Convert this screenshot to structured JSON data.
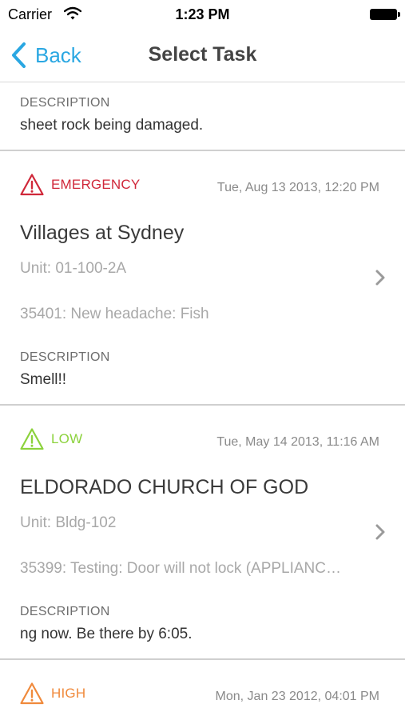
{
  "status_bar": {
    "carrier": "Carrier",
    "time": "1:23 PM"
  },
  "nav": {
    "back_label": "Back",
    "title": "Select Task"
  },
  "partial_card": {
    "description_label": "DESCRIPTION",
    "description": "sheet rock being damaged."
  },
  "tasks": [
    {
      "priority": "EMERGENCY",
      "priority_color": "#d0283a",
      "date": "Tue, Aug 13 2013, 12:20 PM",
      "site": "Villages at Sydney",
      "unit": "Unit: 01-100-2A",
      "task": "35401: New headache: Fish",
      "description_label": "DESCRIPTION",
      "description": "Smell!!"
    },
    {
      "priority": "LOW",
      "priority_color": "#8cd23c",
      "date": "Tue, May 14 2013, 11:16 AM",
      "site": "ELDORADO CHURCH OF GOD",
      "unit": "Unit: Bldg-102",
      "task": "35399: Testing: Door will not lock (APPLIANC…",
      "description_label": "DESCRIPTION",
      "description": "ng now. Be there by 6:05."
    },
    {
      "priority": "HIGH",
      "priority_color": "#f08a3c",
      "date": "Mon, Jan 23 2012, 04:01 PM"
    }
  ],
  "icons": {
    "back": "chevron-left-icon",
    "priority": "warning-triangle-icon",
    "disclosure": "chevron-right-icon",
    "wifi": "wifi-icon",
    "battery": "battery-icon"
  },
  "colors": {
    "accent": "#2aa7e2"
  }
}
